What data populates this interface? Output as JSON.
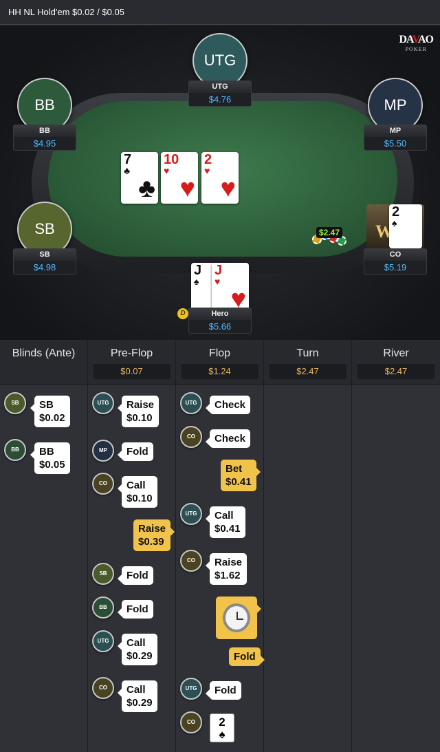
{
  "title": "HH NL Hold'em $0.02 / $0.05",
  "brand": {
    "part1": "DA",
    "part2": "V",
    "part3": "AO",
    "sub": "POKER"
  },
  "felt_logo": "O",
  "seats": {
    "utg": {
      "avatar": "UTG",
      "name": "UTG",
      "stack": "$4.76",
      "color": "#2f5a5c"
    },
    "bb": {
      "avatar": "BB",
      "name": "BB",
      "stack": "$4.95",
      "color": "#2e5a3c"
    },
    "mp": {
      "avatar": "MP",
      "name": "MP",
      "stack": "$5.50",
      "color": "#263245"
    },
    "sb": {
      "avatar": "SB",
      "name": "SB",
      "stack": "$4.98",
      "color": "#56662e"
    },
    "co": {
      "name": "CO",
      "stack": "$5.19"
    },
    "hero": {
      "name": "Hero",
      "stack": "$5.66"
    }
  },
  "board": [
    {
      "rank": "7",
      "suit": "♣",
      "color": "black"
    },
    {
      "rank": "10",
      "suit": "♥",
      "color": "red"
    },
    {
      "rank": "2",
      "suit": "♥",
      "color": "red"
    }
  ],
  "hero_cards": [
    {
      "rank": "J",
      "suit": "♠",
      "color": "black"
    },
    {
      "rank": "J",
      "suit": "♥",
      "color": "red"
    }
  ],
  "co_card": {
    "rank": "2",
    "suit": "♠"
  },
  "pot": "$2.47",
  "win_text": "WIN",
  "dealer": "D",
  "streets": [
    {
      "name": "Blinds (Ante)",
      "pot": ""
    },
    {
      "name": "Pre-Flop",
      "pot": "$0.07"
    },
    {
      "name": "Flop",
      "pot": "$1.24"
    },
    {
      "name": "Turn",
      "pot": "$2.47"
    },
    {
      "name": "River",
      "pot": "$2.47"
    }
  ],
  "actions": {
    "blinds": [
      {
        "player": "SB",
        "text": "SB\n$0.02"
      },
      {
        "player": "BB",
        "text": "BB\n$0.05"
      }
    ],
    "preflop": [
      {
        "player": "UTG",
        "text": "Raise\n$0.10"
      },
      {
        "player": "MP",
        "text": "Fold"
      },
      {
        "player": "CO",
        "text": "Call\n$0.10"
      },
      {
        "player": "Hero",
        "text": "Raise\n$0.39"
      },
      {
        "player": "SB",
        "text": "Fold"
      },
      {
        "player": "BB",
        "text": "Fold"
      },
      {
        "player": "UTG",
        "text": "Call\n$0.29"
      },
      {
        "player": "CO",
        "text": "Call\n$0.29"
      }
    ],
    "flop": [
      {
        "player": "UTG",
        "text": "Check"
      },
      {
        "player": "CO",
        "text": "Check"
      },
      {
        "player": "Hero",
        "text": "Bet\n$0.41"
      },
      {
        "player": "UTG",
        "text": "Call\n$0.41"
      },
      {
        "player": "CO",
        "text": "Raise\n$1.62"
      },
      {
        "player": "Hero",
        "text": "Fold"
      },
      {
        "player": "UTG",
        "text": "Fold"
      },
      {
        "player": "CO",
        "card_rank": "2",
        "card_suit": "♠"
      }
    ]
  }
}
